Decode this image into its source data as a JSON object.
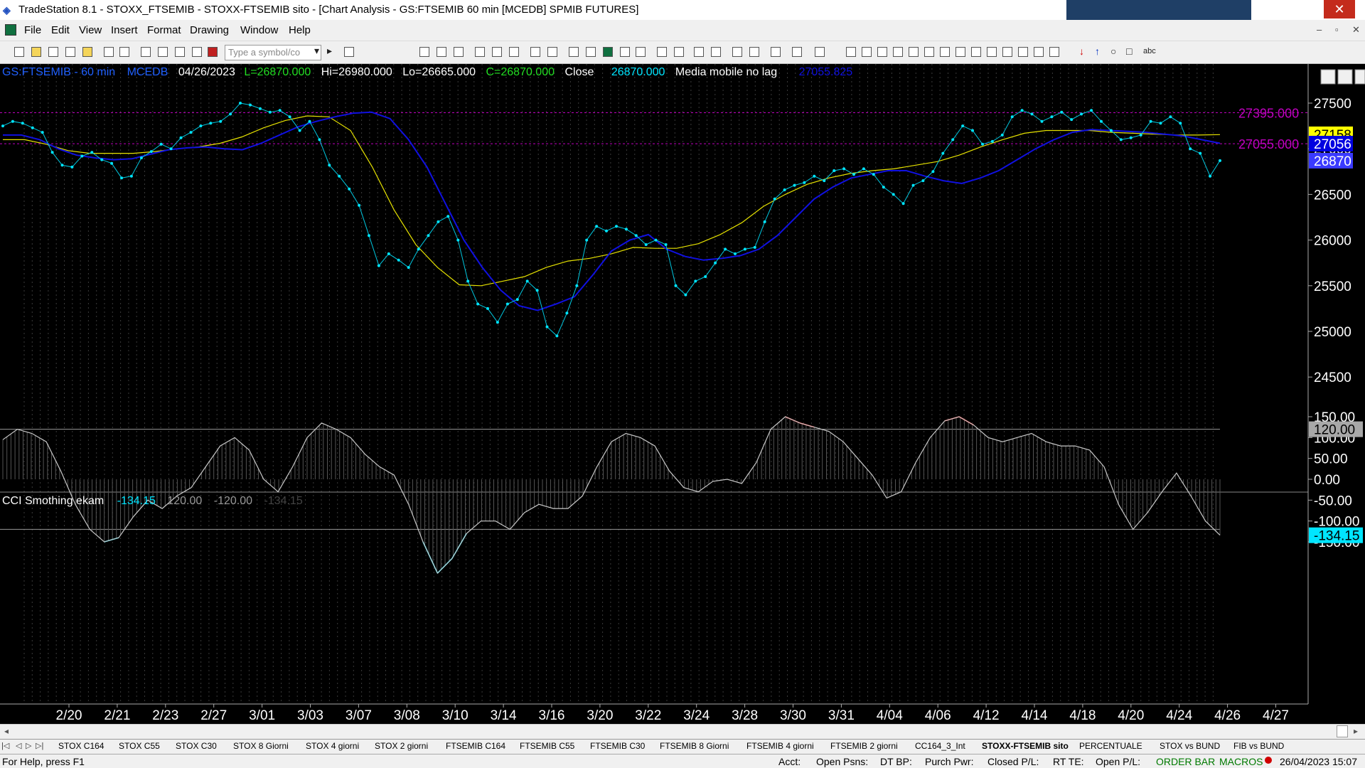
{
  "window": {
    "title": "TradeStation 8.1 - STOXX_FTSEMIB - STOXX-FTSEMIB sito - [Chart Analysis - GS:FTSEMIB  60 min  [MCEDB] SPMIB FUTURES]",
    "minimize": "–",
    "restore": "❐",
    "close": "✕"
  },
  "menu": {
    "items": [
      "File",
      "Edit",
      "View",
      "Insert",
      "Format",
      "Drawing",
      "Window",
      "Help"
    ],
    "mdi_buttons": [
      "–",
      "▫",
      "✕"
    ]
  },
  "toolbar": {
    "symbol_placeholder": "Type a symbol/co",
    "abc": "abc"
  },
  "chart_header": {
    "symbol": "GS:FTSEMIB - 60 min",
    "exchange": "MCEDB",
    "date": "04/26/2023",
    "last": "L=26870.000",
    "high": "Hi=26980.000",
    "low": "Lo=26665.000",
    "close": "C=26870.000",
    "close_label": "Close",
    "close_value": "26870.000",
    "indicator_name": "Media mobile no lag",
    "indicator_value": "27055.825"
  },
  "price_levels": {
    "upper": "27395.000",
    "lower": "27055.000"
  },
  "price_flags": {
    "yellow": "27158",
    "blue": "27056",
    "current": "26870"
  },
  "cci_header": {
    "name": "CCI Smothing ekam",
    "value": "-134.15",
    "upper": "120.00",
    "lower": "-120.00",
    "faded": "-134.15"
  },
  "cci_flags": {
    "upper": "120.00",
    "current": "-134.15"
  },
  "colors": {
    "price": "#00e5ff",
    "ma_fast": "#1010e0",
    "ma_slow": "#e6e200",
    "cci_line": "#c8c8c8",
    "cci_over": "#ff2020",
    "cci_under": "#00e5ff",
    "level_line": "#c000c0"
  },
  "chart_data": [
    {
      "type": "line",
      "title": "GS:FTSEMIB - 60 min",
      "x": [
        "2/20",
        "2/21",
        "2/23",
        "2/27",
        "3/01",
        "3/03",
        "3/07",
        "3/08",
        "3/10",
        "3/14",
        "3/16",
        "3/20",
        "3/22",
        "3/24",
        "3/28",
        "3/30",
        "3/31",
        "4/04",
        "4/06",
        "4/12",
        "4/14",
        "4/18",
        "4/20",
        "4/24",
        "4/26",
        "4/27"
      ],
      "ylim": [
        24300,
        27600
      ],
      "yticks": [
        "27500",
        "27000",
        "26500",
        "26000",
        "25500",
        "25000",
        "24500"
      ],
      "hlines": [
        27395,
        27055
      ],
      "series": [
        {
          "name": "",
          "values": [
            27250,
            27300,
            27280,
            27230,
            27180,
            26960,
            26820,
            26800,
            26920,
            26960,
            26880,
            26840,
            26680,
            26700,
            26900,
            26970,
            27050,
            27000,
            27120,
            27180,
            27250,
            27280,
            27300,
            27380,
            27500,
            27480,
            27440,
            27400,
            27420,
            27350,
            27200,
            27300,
            27100,
            26820,
            26700,
            26560,
            26380,
            26050,
            25720,
            25850,
            25780,
            25700,
            25900,
            26050,
            26200,
            26260,
            26000,
            25550,
            25300,
            25250,
            25100,
            25300,
            25350,
            25550,
            25450,
            25050,
            24950,
            25200,
            25500,
            26000,
            26150,
            26100,
            26150,
            26120,
            26050,
            25950,
            26000,
            25950,
            25500,
            25400,
            25550,
            25600,
            25750,
            25900,
            25850,
            25900,
            25920,
            26200,
            26450,
            26550,
            26600,
            26630,
            26700,
            26650,
            26760,
            26780,
            26720,
            26780,
            26720,
            26580,
            26500,
            26400,
            26600,
            26650,
            26750,
            26950,
            27100,
            27250,
            27200,
            27050,
            27080,
            27150,
            27350,
            27420,
            27380,
            27300,
            27350,
            27400,
            27320,
            27380,
            27420,
            27300,
            27200,
            27100,
            27120,
            27150,
            27300,
            27280,
            27350,
            27280,
            27000,
            26950,
            26700,
            26870
          ]
        },
        {
          "name": "",
          "values": [
            27150,
            27150,
            27100,
            27000,
            26930,
            26900,
            26880,
            26890,
            26940,
            26990,
            27010,
            27020,
            27000,
            26990,
            27060,
            27150,
            27240,
            27300,
            27350,
            27390,
            27400,
            27330,
            27100,
            26800,
            26400,
            26000,
            25700,
            25450,
            25280,
            25230,
            25300,
            25380,
            25620,
            25880,
            26000,
            26060,
            25900,
            25820,
            25780,
            25800,
            25830,
            25900,
            26050,
            26250,
            26450,
            26580,
            26680,
            26720,
            26760,
            26760,
            26700,
            26650,
            26620,
            26680,
            26760,
            26880,
            27000,
            27100,
            27180,
            27210,
            27200,
            27190,
            27180,
            27160,
            27140,
            27100,
            27060
          ]
        },
        {
          "name": "",
          "values": [
            27100,
            27100,
            27050,
            26980,
            26950,
            26950,
            26950,
            26970,
            27000,
            27020,
            27060,
            27130,
            27230,
            27310,
            27360,
            27350,
            27200,
            26800,
            26330,
            25950,
            25700,
            25510,
            25500,
            25550,
            25600,
            25700,
            25770,
            25800,
            25850,
            25920,
            25910,
            25910,
            25960,
            26060,
            26190,
            26370,
            26500,
            26610,
            26680,
            26730,
            26760,
            26780,
            26820,
            26860,
            26930,
            27020,
            27100,
            27170,
            27200,
            27200,
            27200,
            27180,
            27170,
            27160,
            27150,
            27150,
            27155
          ]
        }
      ]
    },
    {
      "type": "line",
      "title": "CCI Smothing ekam",
      "ylim": [
        -190,
        175
      ],
      "yticks": [
        "150.00",
        "100.00",
        "50.00",
        "0.00",
        "-50.00",
        "-100.00",
        "-150.00"
      ],
      "hlines": [
        120,
        -120
      ],
      "series": [
        {
          "name": "",
          "values": [
            95,
            120,
            110,
            90,
            20,
            -60,
            -120,
            -150,
            -140,
            -90,
            -50,
            -70,
            -40,
            -20,
            30,
            80,
            100,
            70,
            0,
            -30,
            30,
            100,
            135,
            120,
            100,
            60,
            30,
            10,
            -60,
            -150,
            -225,
            -190,
            -130,
            -100,
            -100,
            -120,
            -80,
            -60,
            -70,
            -70,
            -40,
            30,
            90,
            110,
            100,
            80,
            20,
            -20,
            -30,
            -5,
            0,
            -10,
            40,
            120,
            150,
            135,
            125,
            115,
            90,
            50,
            10,
            -45,
            -30,
            40,
            100,
            140,
            150,
            130,
            100,
            90,
            100,
            110,
            90,
            80,
            80,
            70,
            30,
            -60,
            -120,
            -80,
            -30,
            15,
            -40,
            -100,
            -134
          ]
        }
      ]
    }
  ],
  "tabs": {
    "nav": [
      "|◁",
      "◁",
      "▷",
      "▷|"
    ],
    "items": [
      "STOX C164",
      "STOX C55",
      "STOX C30",
      "STOX 8 Giorni",
      "STOX 4 giorni",
      "STOX 2 giorni",
      "FTSEMIB C164",
      "FTSEMIB C55",
      "FTSEMIB C30",
      "FTSEMIB 8 Giorni",
      "FTSEMIB 4 giorni",
      "FTSEMIB 2 giorni",
      "CC164_3_Int",
      "STOXX-FTSEMIB sito",
      "PERCENTUALE",
      "STOX vs BUND",
      "FIB vs BUND"
    ],
    "active": "STOXX-FTSEMIB sito"
  },
  "status": {
    "help": "For Help, press F1",
    "acct": "Acct:",
    "open_psns": "Open Psns:",
    "dt_bp": "DT BP:",
    "purch_pwr": "Purch Pwr:",
    "closed_pl": "Closed P/L:",
    "rt_te": "RT TE:",
    "open_pl": "Open P/L:",
    "order_bar": "ORDER BAR",
    "macros": "MACROS",
    "datetime": "26/04/2023 15:07"
  }
}
